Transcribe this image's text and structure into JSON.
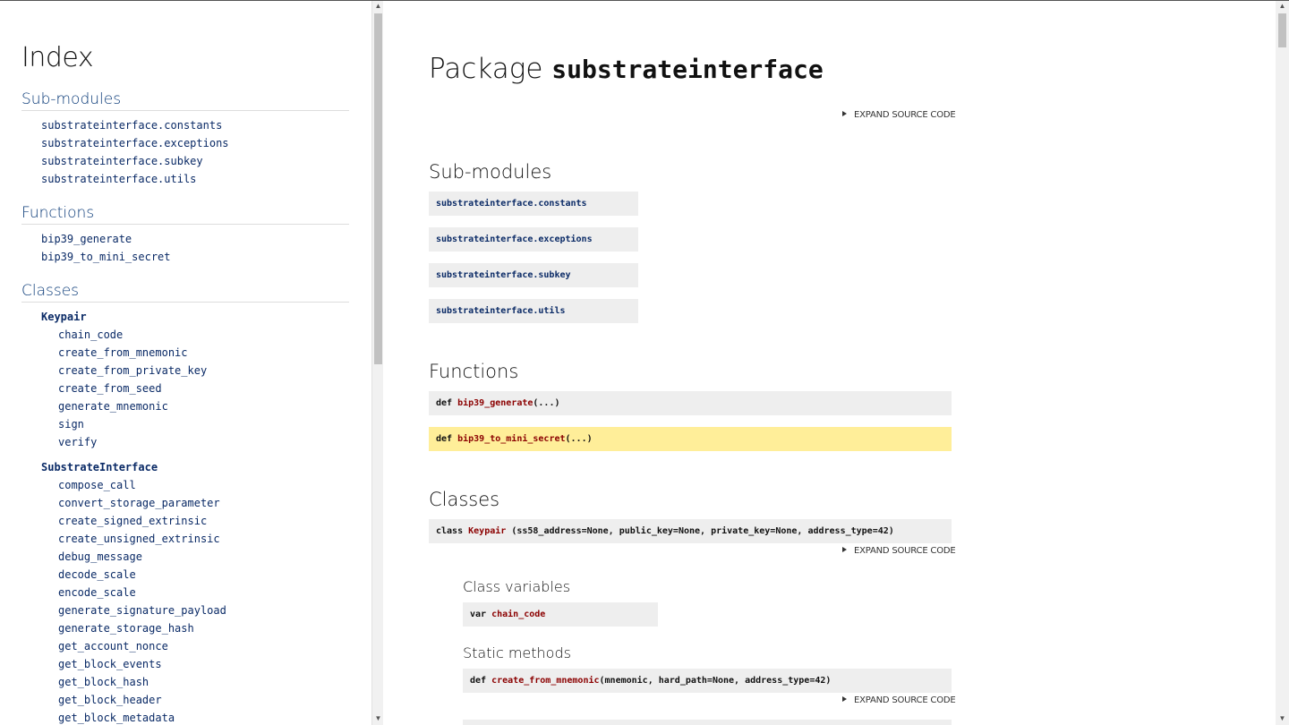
{
  "sidebar": {
    "title": "Index",
    "submodules_heading": "Sub-modules",
    "submodules": [
      "substrateinterface.constants",
      "substrateinterface.exceptions",
      "substrateinterface.subkey",
      "substrateinterface.utils"
    ],
    "functions_heading": "Functions",
    "functions": [
      "bip39_generate",
      "bip39_to_mini_secret"
    ],
    "classes_heading": "Classes",
    "class_keypair": "Keypair",
    "keypair_members": [
      "chain_code",
      "create_from_mnemonic",
      "create_from_private_key",
      "create_from_seed",
      "generate_mnemonic",
      "sign",
      "verify"
    ],
    "class_substrate": "SubstrateInterface",
    "substrate_members": [
      "compose_call",
      "convert_storage_parameter",
      "create_signed_extrinsic",
      "create_unsigned_extrinsic",
      "debug_message",
      "decode_scale",
      "encode_scale",
      "generate_signature_payload",
      "generate_storage_hash",
      "get_account_nonce",
      "get_block_events",
      "get_block_hash",
      "get_block_header",
      "get_block_metadata"
    ]
  },
  "main": {
    "title_prefix": "Package",
    "title_name": "substrateinterface",
    "expand_label": "EXPAND SOURCE CODE",
    "submodules_heading": "Sub-modules",
    "submodules": [
      "substrateinterface.constants",
      "substrateinterface.exceptions",
      "substrateinterface.subkey",
      "substrateinterface.utils"
    ],
    "functions_heading": "Functions",
    "def_kw": "def",
    "func1_name": "bip39_generate",
    "func1_args": "(...)",
    "func2_name": "bip39_to_mini_secret",
    "func2_args": "(...)",
    "classes_heading": "Classes",
    "class_kw": "class",
    "class_name": "Keypair",
    "class_args": " (ss58_address=None, public_key=None, private_key=None, address_type=42)",
    "class_vars_heading": "Class variables",
    "var_kw": "var",
    "var_name": "chain_code",
    "static_heading": "Static methods",
    "static_name": "create_from_mnemonic",
    "static_args": "(mnemonic, hard_path=None, address_type=42)"
  },
  "colors": {
    "link": "#0a2a66",
    "name": "#8b0000",
    "highlight": "#ffee99",
    "box": "#eeeeee"
  }
}
